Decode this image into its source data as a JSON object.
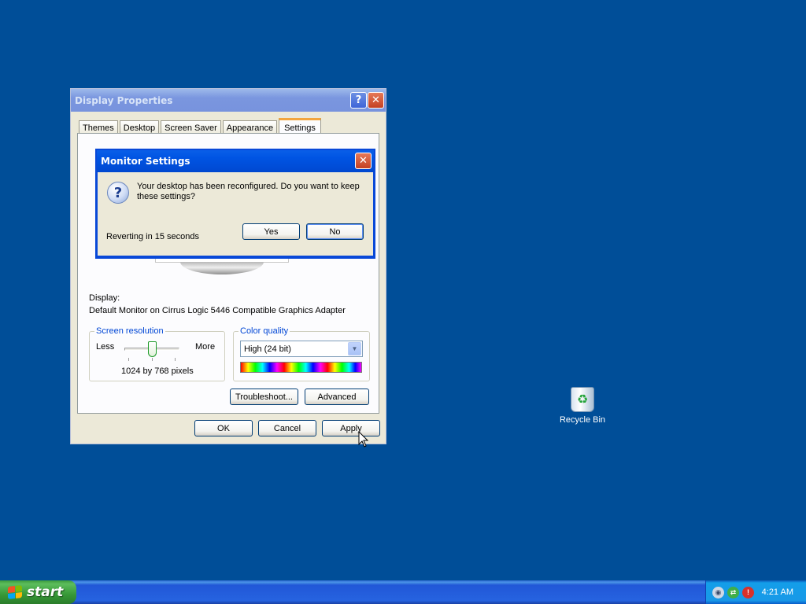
{
  "display_properties": {
    "title": "Display Properties",
    "help_label": "?",
    "close_label": "✕",
    "tabs": [
      {
        "label": "Themes"
      },
      {
        "label": "Desktop"
      },
      {
        "label": "Screen Saver"
      },
      {
        "label": "Appearance"
      },
      {
        "label": "Settings",
        "selected": true
      }
    ],
    "display_label": "Display:",
    "display_value": "Default Monitor on Cirrus Logic 5446 Compatible Graphics Adapter",
    "screen_resolution": {
      "legend": "Screen resolution",
      "less": "Less",
      "more": "More",
      "value": "1024 by 768 pixels"
    },
    "color_quality": {
      "legend": "Color quality",
      "selected": "High (24 bit)"
    },
    "troubleshoot_label": "Troubleshoot...",
    "advanced_label": "Advanced",
    "ok_label": "OK",
    "cancel_label": "Cancel",
    "apply_label": "Apply"
  },
  "monitor_settings": {
    "title": "Monitor Settings",
    "close_label": "✕",
    "message": "Your desktop has been reconfigured.  Do you want to keep these settings?",
    "countdown": "Reverting in 15 seconds",
    "yes_label": "Yes",
    "no_label": "No",
    "icon": "question-icon"
  },
  "desktop": {
    "recycle_bin_label": "Recycle Bin"
  },
  "taskbar": {
    "start_label": "start",
    "clock": "4:21 AM",
    "tray_icons": [
      "volume-icon",
      "network-icon",
      "security-alert-icon"
    ]
  },
  "colors": {
    "desktop": "#004e98",
    "dialog_face": "#ece9d8",
    "active_title": "#0054e3",
    "inactive_title": "#7a96df",
    "groupbox_legend": "#0046d5"
  }
}
